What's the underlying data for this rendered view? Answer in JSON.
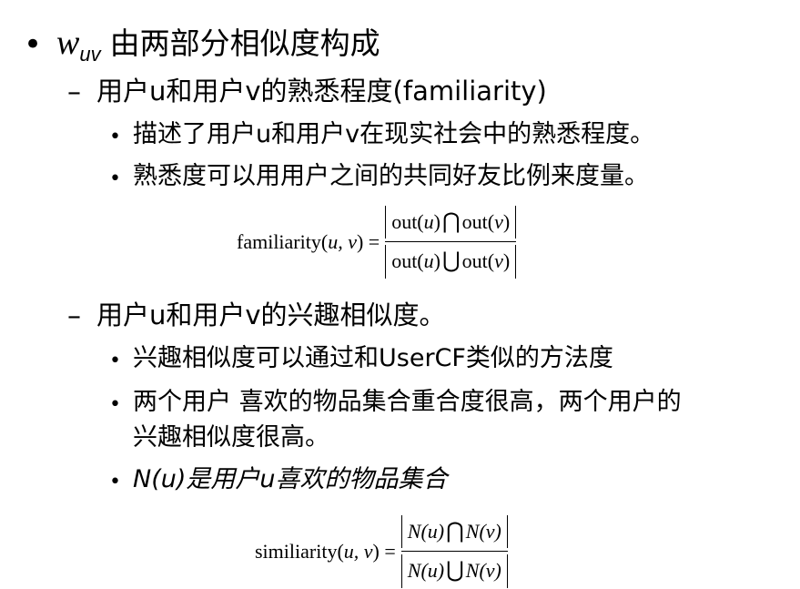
{
  "bullet_symbols": {
    "level1": "•",
    "level2": "–",
    "level3": "•"
  },
  "heading": {
    "w": "w",
    "w_subscript": "uv",
    "text": "由两部分相似度构成"
  },
  "section1": {
    "title": "用户u和用户v的熟悉程度(familiarity)",
    "points": [
      "描述了用户u和用户v在现实社会中的熟悉程度。",
      "熟悉度可以用用户之间的共同好友比例来度量。"
    ],
    "formula": {
      "lhs": "familiarity(",
      "lhs_vars": "u, v",
      "lhs_close": ") =",
      "numerator": {
        "left": "out(",
        "left_var": "u",
        "left_close": ")",
        "operator": "⋂",
        "right": "out(",
        "right_var": "v",
        "right_close": ")"
      },
      "denominator": {
        "left": "out(",
        "left_var": "u",
        "left_close": ")",
        "operator": "⋃",
        "right": "out(",
        "right_var": "v",
        "right_close": ")"
      }
    }
  },
  "section2": {
    "title": "用户u和用户v的兴趣相似度。",
    "points": [
      "兴趣相似度可以通过和UserCF类似的方法度",
      "两个用户 喜欢的物品集合重合度很高，两个用户的",
      "兴趣相似度很高。",
      "N(u)是用户u喜欢的物品集合"
    ],
    "formula": {
      "lhs": "similiarity(",
      "lhs_vars": "u, v",
      "lhs_close": ") =",
      "numerator": {
        "left": "N(",
        "left_var": "u",
        "left_close": ")",
        "operator": "⋂",
        "right": "N(",
        "right_var": "v",
        "right_close": ")"
      },
      "denominator": {
        "left": "N(",
        "left_var": "u",
        "left_close": ")",
        "operator": "⋃",
        "right": "N(",
        "right_var": "v",
        "right_close": ")"
      }
    }
  }
}
